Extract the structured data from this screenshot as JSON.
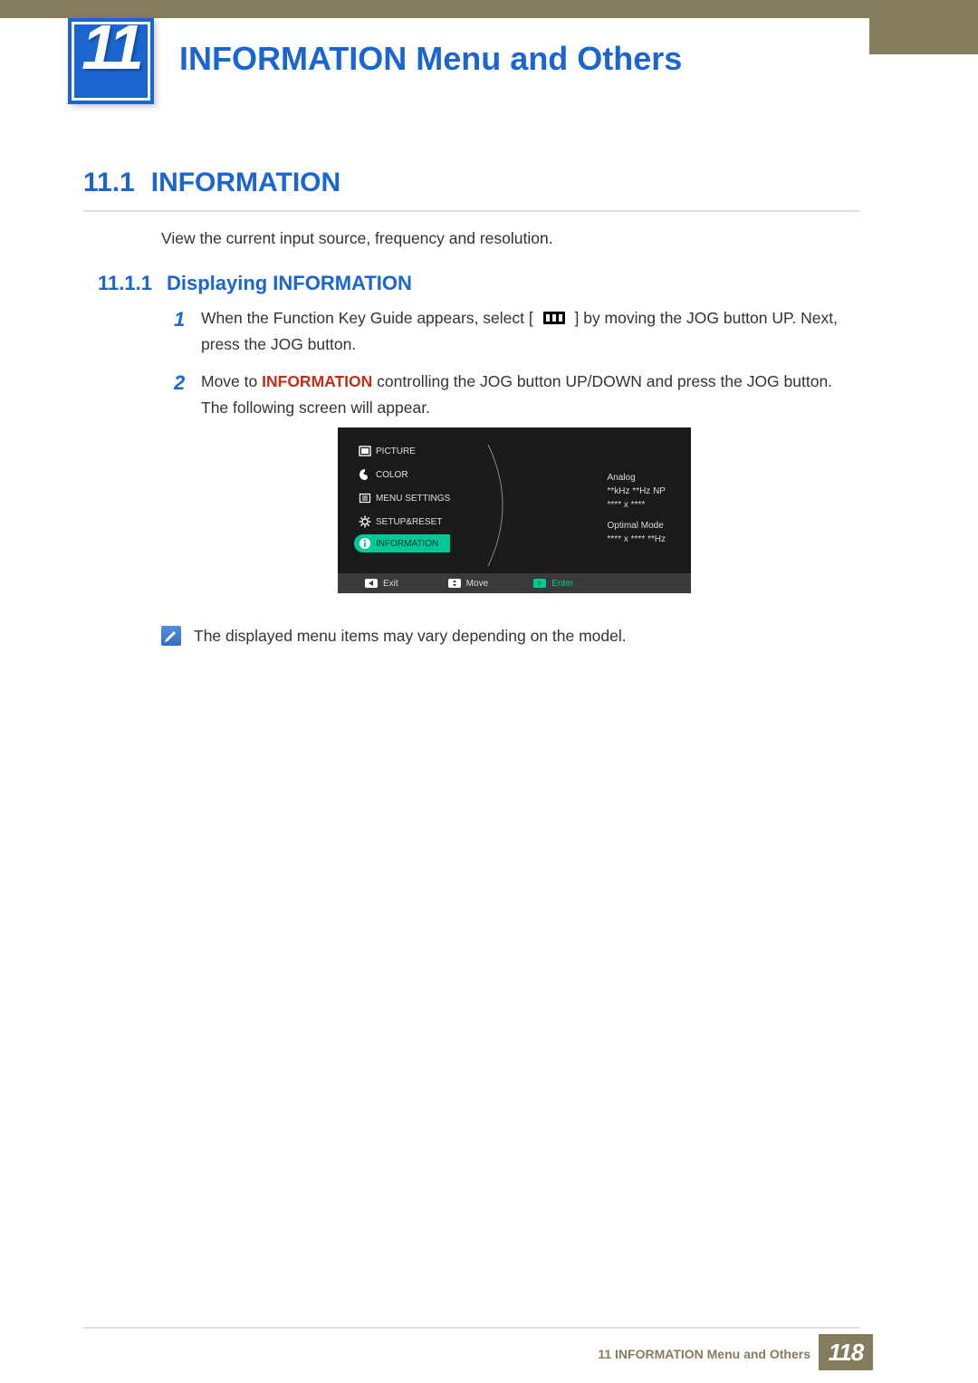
{
  "chapter_num": "11",
  "page_title": "INFORMATION Menu and Others",
  "section": {
    "num": "11.1",
    "title": "INFORMATION"
  },
  "intro": "View the current input source, frequency and resolution.",
  "subsection": {
    "num": "11.1.1",
    "title": "Displaying INFORMATION"
  },
  "steps": {
    "s1a": "When the Function Key Guide appears, select [",
    "s1b": "] by moving the JOG button UP. Next, press the JOG button.",
    "s2a": "Move to ",
    "s2kw": "INFORMATION",
    "s2b": " controlling the JOG button UP/DOWN and press the JOG button. The following screen will appear."
  },
  "osd": {
    "items": [
      "PICTURE",
      "COLOR",
      "MENU SETTINGS",
      "SETUP&RESET",
      "INFORMATION"
    ],
    "right": {
      "l1": "Analog",
      "l2": "**kHz **Hz NP",
      "l3": "**** x ****",
      "l4": "Optimal Mode",
      "l5": "**** x **** **Hz"
    },
    "bottom": {
      "exit": "Exit",
      "move": "Move",
      "enter": "Enter"
    }
  },
  "note": "The displayed menu items may vary depending on the model.",
  "footer_text": "11 INFORMATION Menu and Others",
  "page_num": "118"
}
